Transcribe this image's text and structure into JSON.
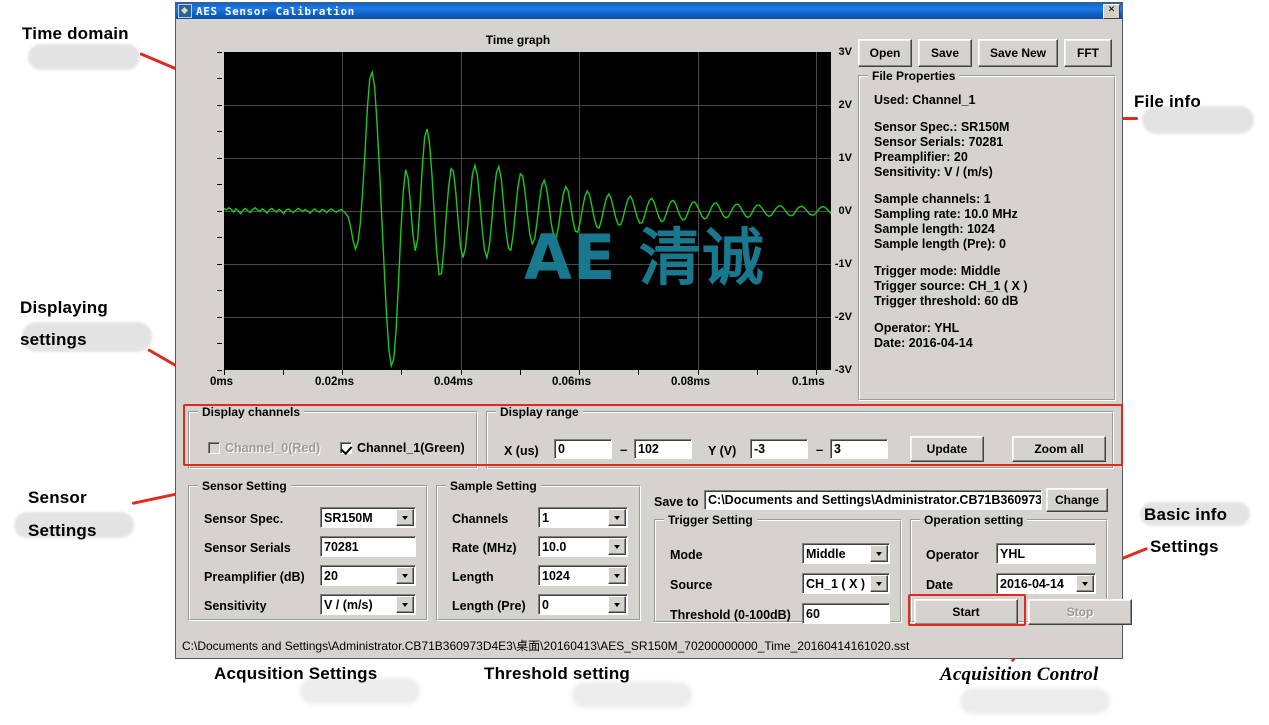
{
  "window": {
    "title": "AES Sensor Calibration",
    "close_label": "✕",
    "app_icon": "app-icon"
  },
  "toolbar": {
    "open_label": "Open",
    "save_label": "Save",
    "save_new_label": "Save New",
    "fft_label": "FFT"
  },
  "chart": {
    "title": "Time graph",
    "watermark": "AE 清诚",
    "trace_color": "#1fc61f",
    "background": "#000000",
    "gridline_color": "#4a4a4a"
  },
  "chart_data": {
    "type": "line",
    "title": "Time graph",
    "xlabel": "",
    "ylabel": "",
    "xlim": [
      0,
      0.1024
    ],
    "ylim": [
      -3,
      3
    ],
    "x_tick_labels": [
      "0ms",
      "0.02ms",
      "0.04ms",
      "0.06ms",
      "0.08ms",
      "0.1ms"
    ],
    "x_tick_values": [
      0,
      0.02,
      0.04,
      0.06,
      0.08,
      0.1
    ],
    "y_tick_labels": [
      "3V",
      "2V",
      "1V",
      "0V",
      "-1V",
      "-2V",
      "-3V"
    ],
    "y_tick_values": [
      3,
      2,
      1,
      0,
      -1,
      -2,
      -3
    ],
    "grid": true,
    "legend": [
      "Channel_1(Green)"
    ],
    "series": [
      {
        "name": "Channel_1",
        "color": "#1fc61f",
        "units_x": "ms",
        "units_y": "V",
        "values": [
          0.05,
          0.02,
          0.06,
          0.03,
          -0.02,
          0.04,
          0.0,
          -0.05,
          0.02,
          0.05,
          0.0,
          -0.03,
          0.03,
          0.06,
          0.02,
          -0.01,
          0.04,
          0.01,
          -0.04,
          0.02,
          0.05,
          0.01,
          -0.02,
          0.03,
          0.0,
          -0.05,
          0.02,
          0.04,
          0.0,
          -0.03,
          0.01,
          0.05,
          0.02,
          -0.01,
          0.03,
          0.0,
          -0.04,
          0.01,
          0.04,
          0.0,
          -0.02,
          0.03,
          0.01,
          -0.03,
          0.02,
          0.04,
          0.0,
          -0.02,
          0.01,
          0.03,
          -0.01,
          -0.05,
          -0.12,
          -0.3,
          -0.55,
          -0.72,
          -0.6,
          -0.25,
          0.35,
          1.1,
          1.95,
          2.5,
          2.62,
          2.35,
          1.7,
          0.85,
          -0.1,
          -1.05,
          -1.95,
          -2.62,
          -2.92,
          -2.8,
          -2.25,
          -1.35,
          -0.4,
          0.35,
          0.78,
          0.62,
          0.15,
          -0.42,
          -0.75,
          -0.55,
          0.1,
          0.85,
          1.4,
          1.55,
          1.28,
          0.7,
          -0.05,
          -0.78,
          -1.2,
          -1.18,
          -0.72,
          -0.1,
          0.45,
          0.8,
          0.75,
          0.35,
          -0.2,
          -0.68,
          -0.88,
          -0.7,
          -0.25,
          0.28,
          0.7,
          0.86,
          0.68,
          0.22,
          -0.32,
          -0.74,
          -0.88,
          -0.66,
          -0.2,
          0.32,
          0.72,
          0.84,
          0.62,
          0.12,
          -0.38,
          -0.7,
          -0.74,
          -0.45,
          0.02,
          0.45,
          0.7,
          0.66,
          0.35,
          -0.08,
          -0.45,
          -0.62,
          -0.52,
          -0.2,
          0.18,
          0.48,
          0.58,
          0.42,
          0.1,
          -0.25,
          -0.48,
          -0.5,
          -0.28,
          0.05,
          0.32,
          0.46,
          0.38,
          0.12,
          -0.18,
          -0.38,
          -0.4,
          -0.22,
          0.05,
          0.28,
          0.38,
          0.3,
          0.08,
          -0.15,
          -0.3,
          -0.32,
          -0.16,
          0.06,
          0.24,
          0.32,
          0.24,
          0.05,
          -0.14,
          -0.26,
          -0.26,
          -0.12,
          0.07,
          0.22,
          0.28,
          0.2,
          0.03,
          -0.13,
          -0.23,
          -0.22,
          -0.09,
          0.08,
          0.2,
          0.24,
          0.16,
          0.02,
          -0.12,
          -0.2,
          -0.18,
          -0.06,
          0.08,
          0.18,
          0.2,
          0.13,
          0.0,
          -0.11,
          -0.17,
          -0.15,
          -0.05,
          0.08,
          0.16,
          0.17,
          0.1,
          -0.01,
          -0.1,
          -0.15,
          -0.13,
          -0.04,
          0.07,
          0.14,
          0.15,
          0.09,
          -0.01,
          -0.09,
          -0.13,
          -0.11,
          -0.03,
          0.06,
          0.12,
          0.13,
          0.08,
          0.0,
          -0.08,
          -0.12,
          -0.1,
          -0.03,
          0.06,
          0.11,
          0.11,
          0.06,
          -0.01,
          -0.07,
          -0.1,
          -0.08,
          -0.02,
          0.05,
          0.09,
          0.1,
          0.06,
          0.0,
          -0.06,
          -0.09,
          -0.08,
          -0.02,
          0.05,
          0.08,
          0.09,
          0.05,
          0.0,
          -0.06,
          -0.08,
          -0.07,
          -0.02,
          0.04,
          0.08,
          0.08,
          0.05,
          0.0,
          -0.05
        ]
      }
    ]
  },
  "file_properties": {
    "legend": "File Properties",
    "lines": [
      "Used:  Channel_1",
      "",
      "Sensor Spec.:  SR150M",
      "Sensor Serials:  70281",
      "Preamplifier:  20",
      "Sensitivity:  V / (m/s)",
      "",
      "Sample channels:  1",
      "Sampling rate:  10.0 MHz",
      "Sample length:  1024",
      "Sample length (Pre):  0",
      "",
      "Trigger mode:  Middle",
      "Trigger source:  CH_1 ( X )",
      "Trigger threshold:  60 dB",
      "",
      "Operator:  YHL",
      "Date:  2016-04-14"
    ]
  },
  "display_channels": {
    "legend": "Display channels",
    "ch0_label": "Channel_0(Red)",
    "ch0_checked": false,
    "ch1_label": "Channel_1(Green)",
    "ch1_checked": true
  },
  "display_range": {
    "legend": "Display range",
    "x_label": "X (us)",
    "x_min": "0",
    "x_max": "102",
    "y_label": "Y (V)",
    "y_min": "-3",
    "y_max": "3",
    "dash": "–",
    "update_label": "Update",
    "zoom_all_label": "Zoom all"
  },
  "sensor_setting": {
    "legend": "Sensor Setting",
    "spec_label": "Sensor Spec.",
    "spec_value": "SR150M",
    "serials_label": "Sensor Serials",
    "serials_value": "70281",
    "preamp_label": "Preamplifier (dB)",
    "preamp_value": "20",
    "sensitivity_label": "Sensitivity",
    "sensitivity_value": "V / (m/s)"
  },
  "sample_setting": {
    "legend": "Sample Setting",
    "channels_label": "Channels",
    "channels_value": "1",
    "rate_label": "Rate (MHz)",
    "rate_value": "10.0",
    "length_label": "Length",
    "length_value": "1024",
    "length_pre_label": "Length (Pre)",
    "length_pre_value": "0"
  },
  "save_to": {
    "label": "Save to",
    "path": "C:\\Documents and Settings\\Administrator.CB71B360973",
    "change_label": "Change"
  },
  "trigger_setting": {
    "legend": "Trigger Setting",
    "mode_label": "Mode",
    "mode_value": "Middle",
    "source_label": "Source",
    "source_value": "CH_1 ( X )",
    "threshold_label": "Threshold (0-100dB)",
    "threshold_value": "60"
  },
  "operation_setting": {
    "legend": "Operation setting",
    "operator_label": "Operator",
    "operator_value": "YHL",
    "date_label": "Date",
    "date_value": "2016-04-14",
    "start_label": "Start",
    "stop_label": "Stop",
    "stop_enabled": false
  },
  "status_bar": {
    "path": "C:\\Documents and Settings\\Administrator.CB71B360973D4E3\\桌面\\20160413\\AES_SR150M_70200000000_Time_20160414161020.sst"
  },
  "annotations": {
    "time_domain": "Time domain",
    "displaying_settings_line1": "Displaying",
    "displaying_settings_line2": "settings",
    "sensor_settings_line1": "Sensor",
    "sensor_settings_line2": "Settings",
    "file_info": "File info",
    "basic_info": "Basic info",
    "settings": "Settings",
    "acqusition_settings": "Acqusition Settings",
    "threshold_setting": "Threshold setting",
    "acquisition_control": "Acquisition Control",
    "color": "#e02a20"
  }
}
